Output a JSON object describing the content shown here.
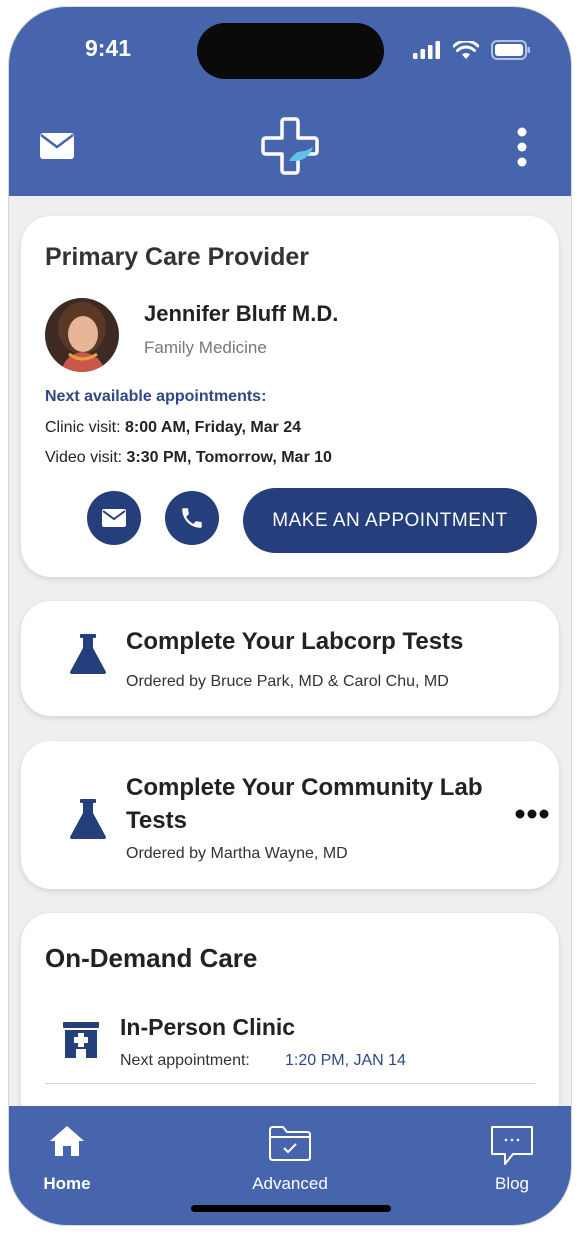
{
  "status_bar": {
    "time": "9:41"
  },
  "header": {
    "mail_icon": "mail-icon",
    "logo_icon": "medical-cross-logo-icon",
    "more_icon": "vertical-dots-icon"
  },
  "pcp": {
    "title": "Primary Care Provider",
    "doctor_name": "Jennifer Bluff M.D.",
    "specialty": "Family Medicine",
    "next_label": "Next available appointments:",
    "clinic_label": "Clinic visit: ",
    "clinic_time": "8:00 AM, Friday, Mar 24",
    "video_label": "Video visit: ",
    "video_time": "3:30 PM, Tomorrow, Mar 10",
    "appointment_button": "MAKE AN APPOINTMENT"
  },
  "labcorp": {
    "title": "Complete Your Labcorp Tests",
    "subtitle": "Ordered by Bruce Park, MD & Carol Chu, MD"
  },
  "community_lab": {
    "title": "Complete Your Community Lab Tests",
    "subtitle": "Ordered by Martha Wayne, MD"
  },
  "on_demand": {
    "title": "On-Demand Care",
    "clinic_title": "In-Person Clinic",
    "next_label": "Next appointment:",
    "next_time": "1:20 PM, JAN 14"
  },
  "tabs": [
    {
      "label": "Home",
      "icon": "home-icon"
    },
    {
      "label": "Advanced",
      "icon": "folder-check-icon"
    },
    {
      "label": "Blog",
      "icon": "chat-bubble-icon"
    }
  ],
  "colors": {
    "brand": "#4665ad",
    "dark_blue": "#253e7c",
    "link_blue": "#2d4885",
    "background": "#efefef"
  }
}
